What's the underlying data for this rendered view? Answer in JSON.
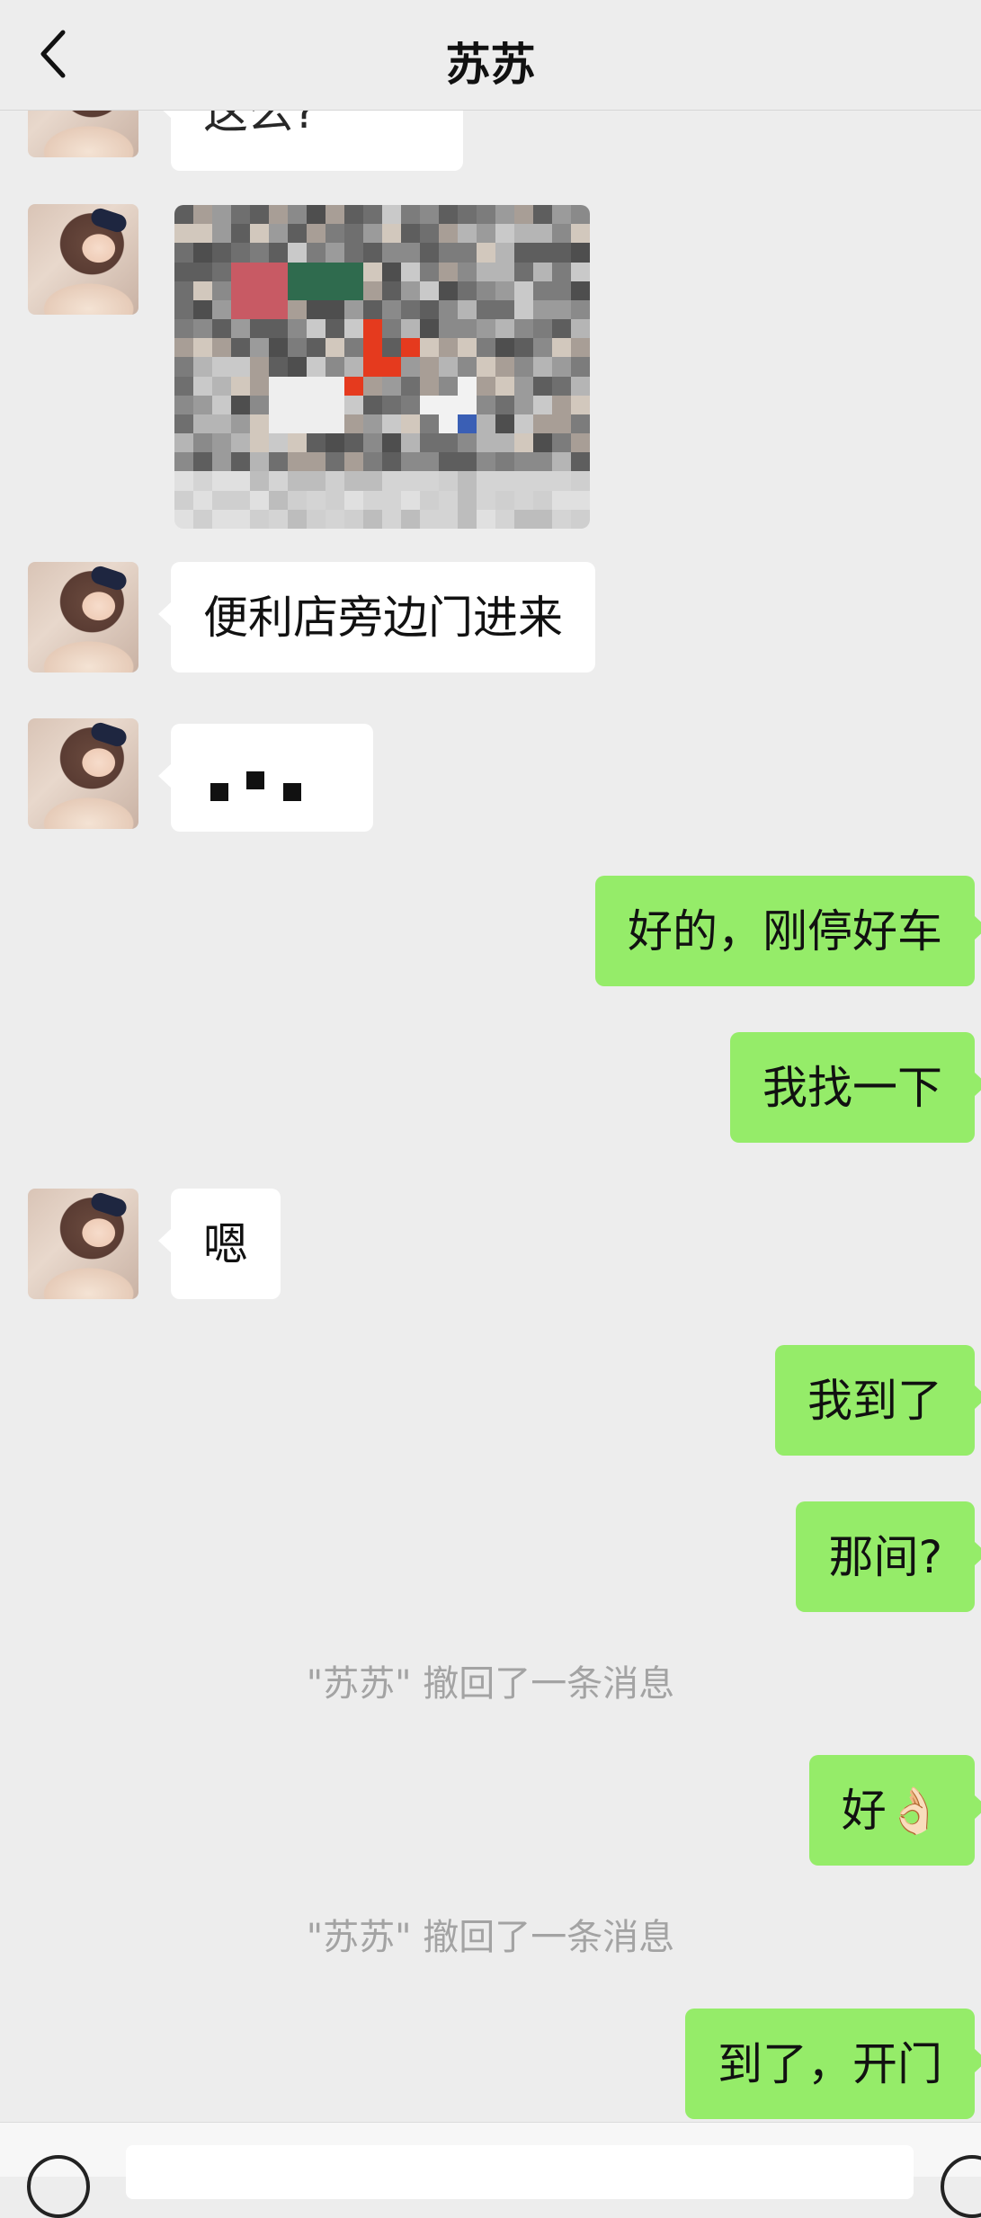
{
  "header": {
    "title": "苏苏",
    "back_icon": "chevron-left-icon"
  },
  "messages": {
    "m0_partial": "这么?",
    "m2": "便利店旁边门进来",
    "m4": "好的，刚停好车",
    "m5": "我找一下",
    "m6": "嗯",
    "m7": "我到了",
    "m8": "那间?",
    "notice1": "\"苏苏\" 撤回了一条消息",
    "m9": "好👌🏻",
    "notice2": "\"苏苏\" 撤回了一条消息",
    "m10": "到了，开门"
  },
  "colors": {
    "right_bubble": "#95ec69",
    "left_bubble": "#ffffff",
    "background": "#ededed"
  }
}
